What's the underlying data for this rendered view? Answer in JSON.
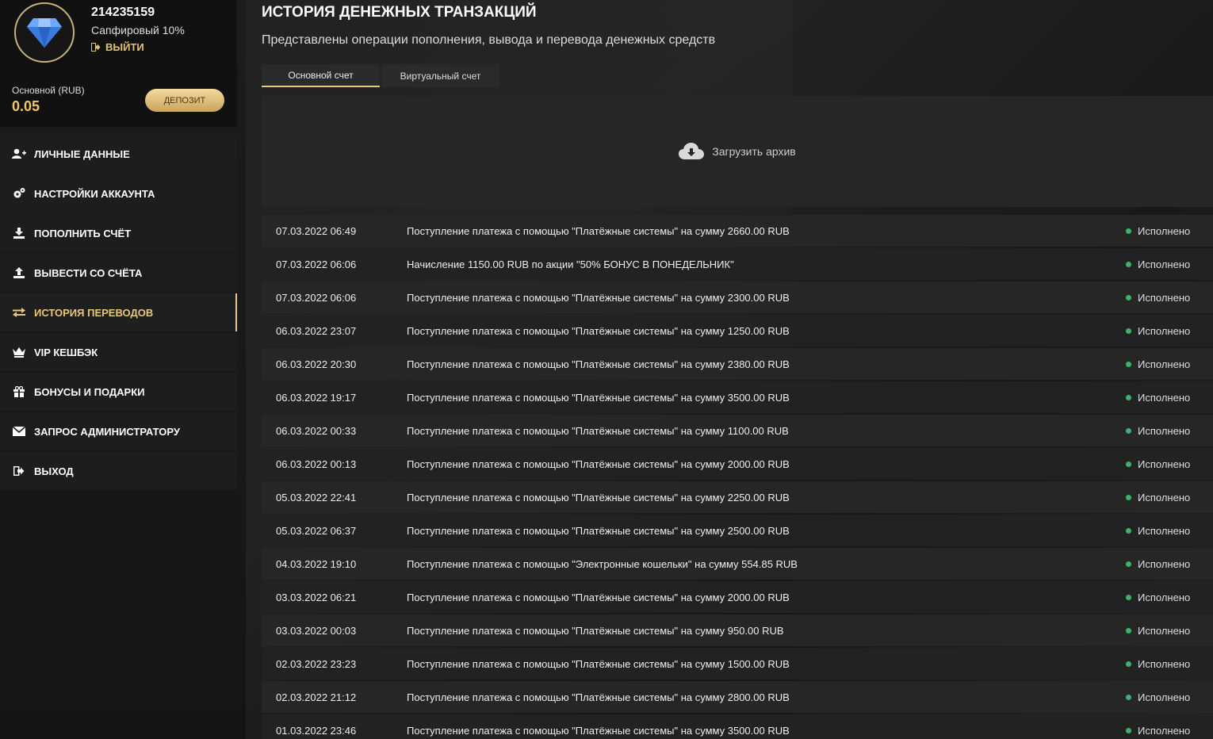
{
  "profile": {
    "user_id": "214235159",
    "level": "Сапфировый 10%",
    "logout_label": "ВЫЙТИ",
    "balance_label": "Основной (RUB)",
    "balance_value": "0.05",
    "deposit_label": "ДЕПОЗИТ"
  },
  "menu": [
    {
      "label": "ЛИЧНЫЕ ДАННЫЕ",
      "icon": "user-plus-icon"
    },
    {
      "label": "НАСТРОЙКИ АККАУНТА",
      "icon": "gears-icon"
    },
    {
      "label": "ПОПОЛНИТЬ СЧЁТ",
      "icon": "download-icon"
    },
    {
      "label": "ВЫВЕСТИ СО СЧЁТА",
      "icon": "upload-icon"
    },
    {
      "label": "ИСТОРИЯ ПЕРЕВОДОВ",
      "icon": "exchange-icon",
      "active": true
    },
    {
      "label": "VIP КЕШБЭК",
      "icon": "crown-icon"
    },
    {
      "label": "БОНУСЫ И ПОДАРКИ",
      "icon": "gift-icon"
    },
    {
      "label": "ЗАПРОС АДМИНИСТРАТОРУ",
      "icon": "envelope-icon"
    },
    {
      "label": "ВЫХОД",
      "icon": "sign-out-icon"
    }
  ],
  "main": {
    "title": "ИСТОРИЯ ДЕНЕЖНЫХ ТРАНЗАКЦИЙ",
    "subtitle": "Представлены операции пополнения, вывода и перевода денежных средств",
    "tabs": [
      "Основной счет",
      "Виртуальный счет"
    ],
    "archive_label": "Загрузить архив"
  },
  "colors": {
    "accent": "#e9c679",
    "status_ok": "#3ab36b"
  },
  "transactions": [
    {
      "date": "07.03.2022 06:49",
      "desc": "Поступление платежа с помощью \"Платёжные системы\" на сумму 2660.00 RUB",
      "status": "Исполнено"
    },
    {
      "date": "07.03.2022 06:06",
      "desc": "Начисление 1150.00 RUB по акции \"50% БОНУС В ПОНЕДЕЛЬНИК\"",
      "status": "Исполнено"
    },
    {
      "date": "07.03.2022 06:06",
      "desc": "Поступление платежа с помощью \"Платёжные системы\" на сумму 2300.00 RUB",
      "status": "Исполнено"
    },
    {
      "date": "06.03.2022 23:07",
      "desc": "Поступление платежа с помощью \"Платёжные системы\" на сумму 1250.00 RUB",
      "status": "Исполнено"
    },
    {
      "date": "06.03.2022 20:30",
      "desc": "Поступление платежа с помощью \"Платёжные системы\" на сумму 2380.00 RUB",
      "status": "Исполнено"
    },
    {
      "date": "06.03.2022 19:17",
      "desc": "Поступление платежа с помощью \"Платёжные системы\" на сумму 3500.00 RUB",
      "status": "Исполнено"
    },
    {
      "date": "06.03.2022 00:33",
      "desc": "Поступление платежа с помощью \"Платёжные системы\" на сумму 1100.00 RUB",
      "status": "Исполнено"
    },
    {
      "date": "06.03.2022 00:13",
      "desc": "Поступление платежа с помощью \"Платёжные системы\" на сумму 2000.00 RUB",
      "status": "Исполнено"
    },
    {
      "date": "05.03.2022 22:41",
      "desc": "Поступление платежа с помощью \"Платёжные системы\" на сумму 2250.00 RUB",
      "status": "Исполнено"
    },
    {
      "date": "05.03.2022 06:37",
      "desc": "Поступление платежа с помощью \"Платёжные системы\" на сумму 2500.00 RUB",
      "status": "Исполнено"
    },
    {
      "date": "04.03.2022 19:10",
      "desc": "Поступление платежа с помощью \"Электронные кошельки\" на сумму 554.85 RUB",
      "status": "Исполнено"
    },
    {
      "date": "03.03.2022 06:21",
      "desc": "Поступление платежа с помощью \"Платёжные системы\" на сумму 2000.00 RUB",
      "status": "Исполнено"
    },
    {
      "date": "03.03.2022 00:03",
      "desc": "Поступление платежа с помощью \"Платёжные системы\" на сумму 950.00 RUB",
      "status": "Исполнено"
    },
    {
      "date": "02.03.2022 23:23",
      "desc": "Поступление платежа с помощью \"Платёжные системы\" на сумму 1500.00 RUB",
      "status": "Исполнено"
    },
    {
      "date": "02.03.2022 21:12",
      "desc": "Поступление платежа с помощью \"Платёжные системы\" на сумму 2800.00 RUB",
      "status": "Исполнено"
    },
    {
      "date": "01.03.2022 23:46",
      "desc": "Поступление платежа с помощью \"Платёжные системы\" на сумму 3500.00 RUB",
      "status": "Исполнено"
    }
  ]
}
